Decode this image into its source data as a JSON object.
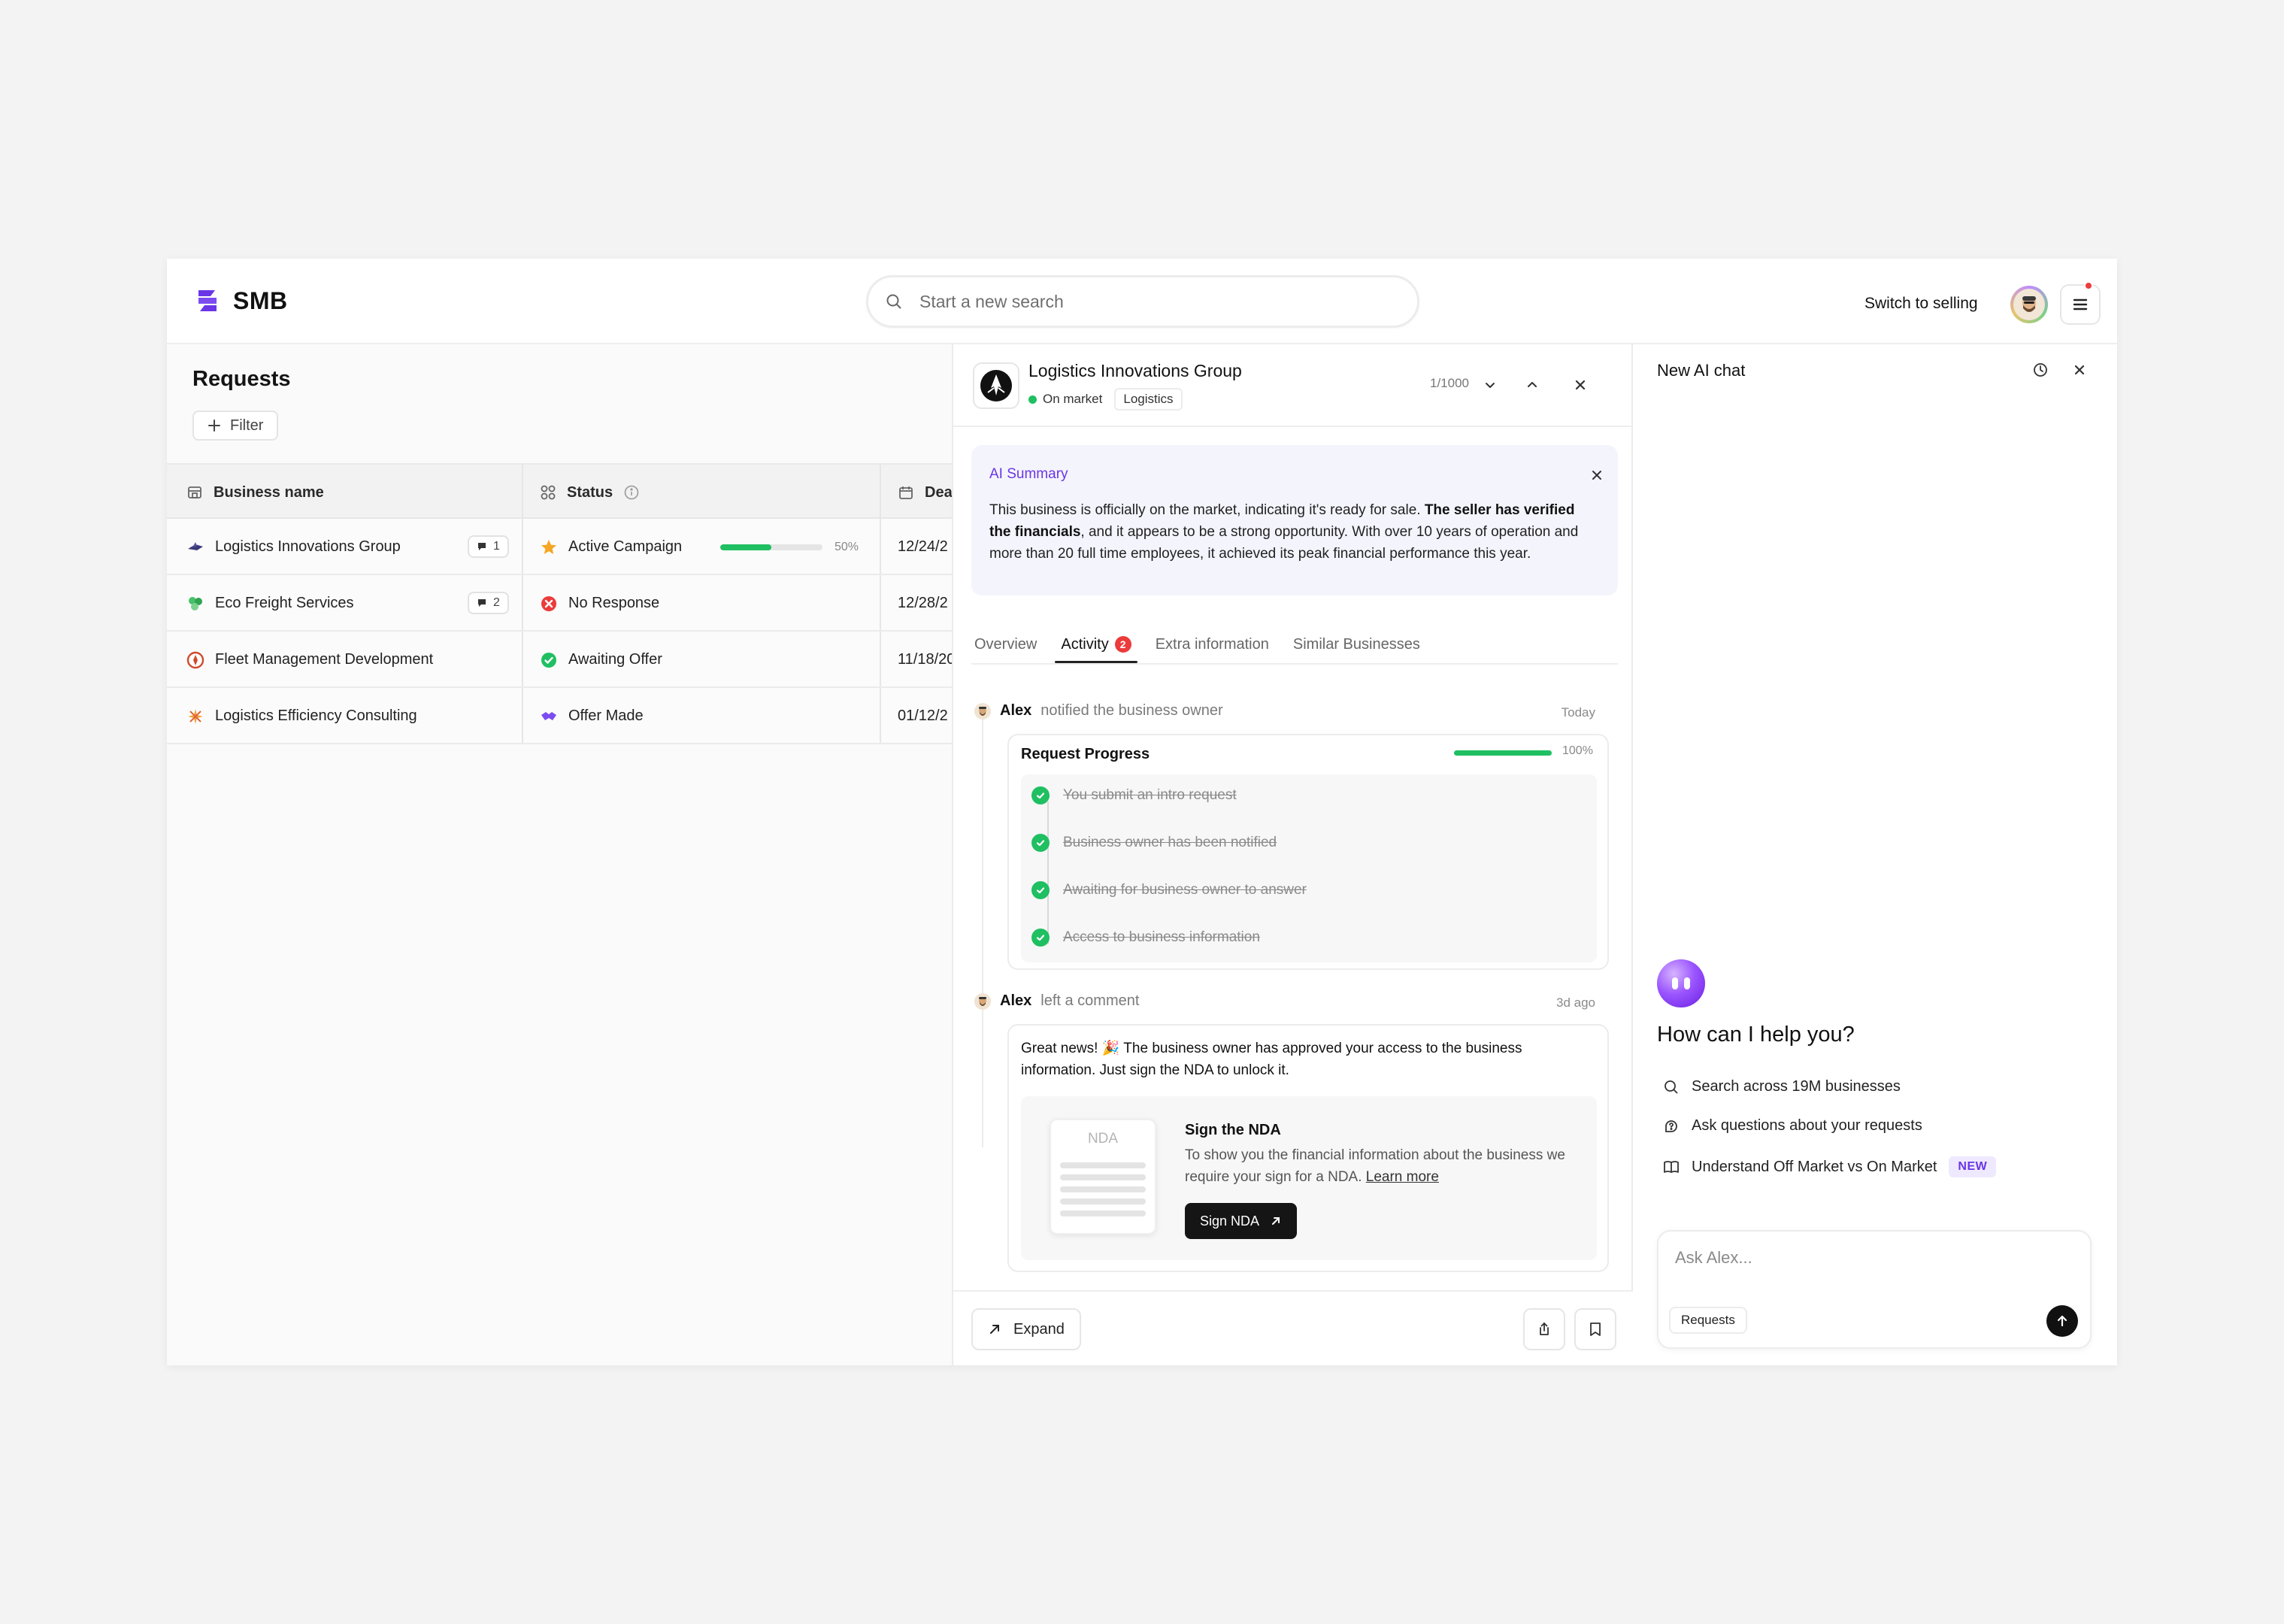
{
  "app": {
    "logo_text": "SMB",
    "search": {
      "placeholder": "Start a new search"
    },
    "switch_label": "Switch to selling"
  },
  "requests": {
    "title": "Requests",
    "filter_label": "Filter",
    "columns": [
      "Business name",
      "Status",
      "Dea"
    ],
    "rows": [
      {
        "name": "Logistics Innovations Group",
        "comments": "1",
        "status": "Active Campaign",
        "status_icon": "star-icon",
        "progress": 50,
        "progress_label": "50%",
        "date": "12/24/2"
      },
      {
        "name": "Eco Freight Services",
        "comments": "2",
        "status": "No Response",
        "status_icon": "x-circle-icon",
        "date": "12/28/2"
      },
      {
        "name": "Fleet Management Development",
        "comments": "",
        "status": "Awaiting Offer",
        "status_icon": "check-circle-icon",
        "date": "11/18/20"
      },
      {
        "name": "Logistics Efficiency Consulting",
        "comments": "",
        "status": "Offer Made",
        "status_icon": "handshake-icon",
        "date": "01/12/2"
      }
    ]
  },
  "detail": {
    "business_name": "Logistics Innovations Group",
    "market_status": "On market",
    "category": "Logistics",
    "pager": "1/1000",
    "summary": {
      "title": "AI Summary",
      "text_1": "This business is officially on the market, indicating it's ready for sale. ",
      "text_bold": "The seller has verified the financials",
      "text_2": ", and it appears to be a strong opportunity. With over 10 years of operation and more than 20 full time employees, it achieved its peak financial performance this year."
    },
    "tabs": [
      {
        "label": "Overview"
      },
      {
        "label": "Activity",
        "badge": "2"
      },
      {
        "label": "Extra information"
      },
      {
        "label": "Similar Businesses"
      }
    ],
    "activity": [
      {
        "who": "Alex",
        "what": "notified the business owner",
        "time": "Today"
      },
      {
        "who": "Alex",
        "what": "left a comment",
        "time": "3d ago"
      }
    ],
    "progress_card": {
      "title": "Request Progress",
      "progress": 100,
      "percent": "100%",
      "steps": [
        "You submit an intro request",
        "Business owner has been notified",
        "Awaiting for business owner to answer",
        "Access to business information"
      ]
    },
    "comment": {
      "text": "Great news! 🎉 The business owner has approved your access to the business information. Just sign the NDA to unlock it.",
      "nda_doc_label": "NDA",
      "nda_title": "Sign the NDA",
      "nda_desc": "To show you the financial information about the business we require your sign for a NDA. ",
      "nda_link": "Learn more",
      "sign_button": "Sign NDA"
    },
    "expand_label": "Expand"
  },
  "ai_chat": {
    "title": "New AI chat",
    "greeting": "How can I help you?",
    "suggestions": [
      {
        "icon": "search-icon",
        "label": "Search across 19M businesses"
      },
      {
        "icon": "question-icon",
        "label": "Ask questions about your requests"
      },
      {
        "icon": "book-icon",
        "label": "Understand Off Market vs On Market",
        "badge": "NEW"
      }
    ],
    "input_placeholder": "Ask Alex...",
    "context_chip": "Requests"
  },
  "colors": {
    "accent": "#6a36e6",
    "success": "#1fbf62",
    "danger": "#ec3b3b",
    "dark": "#151515"
  }
}
